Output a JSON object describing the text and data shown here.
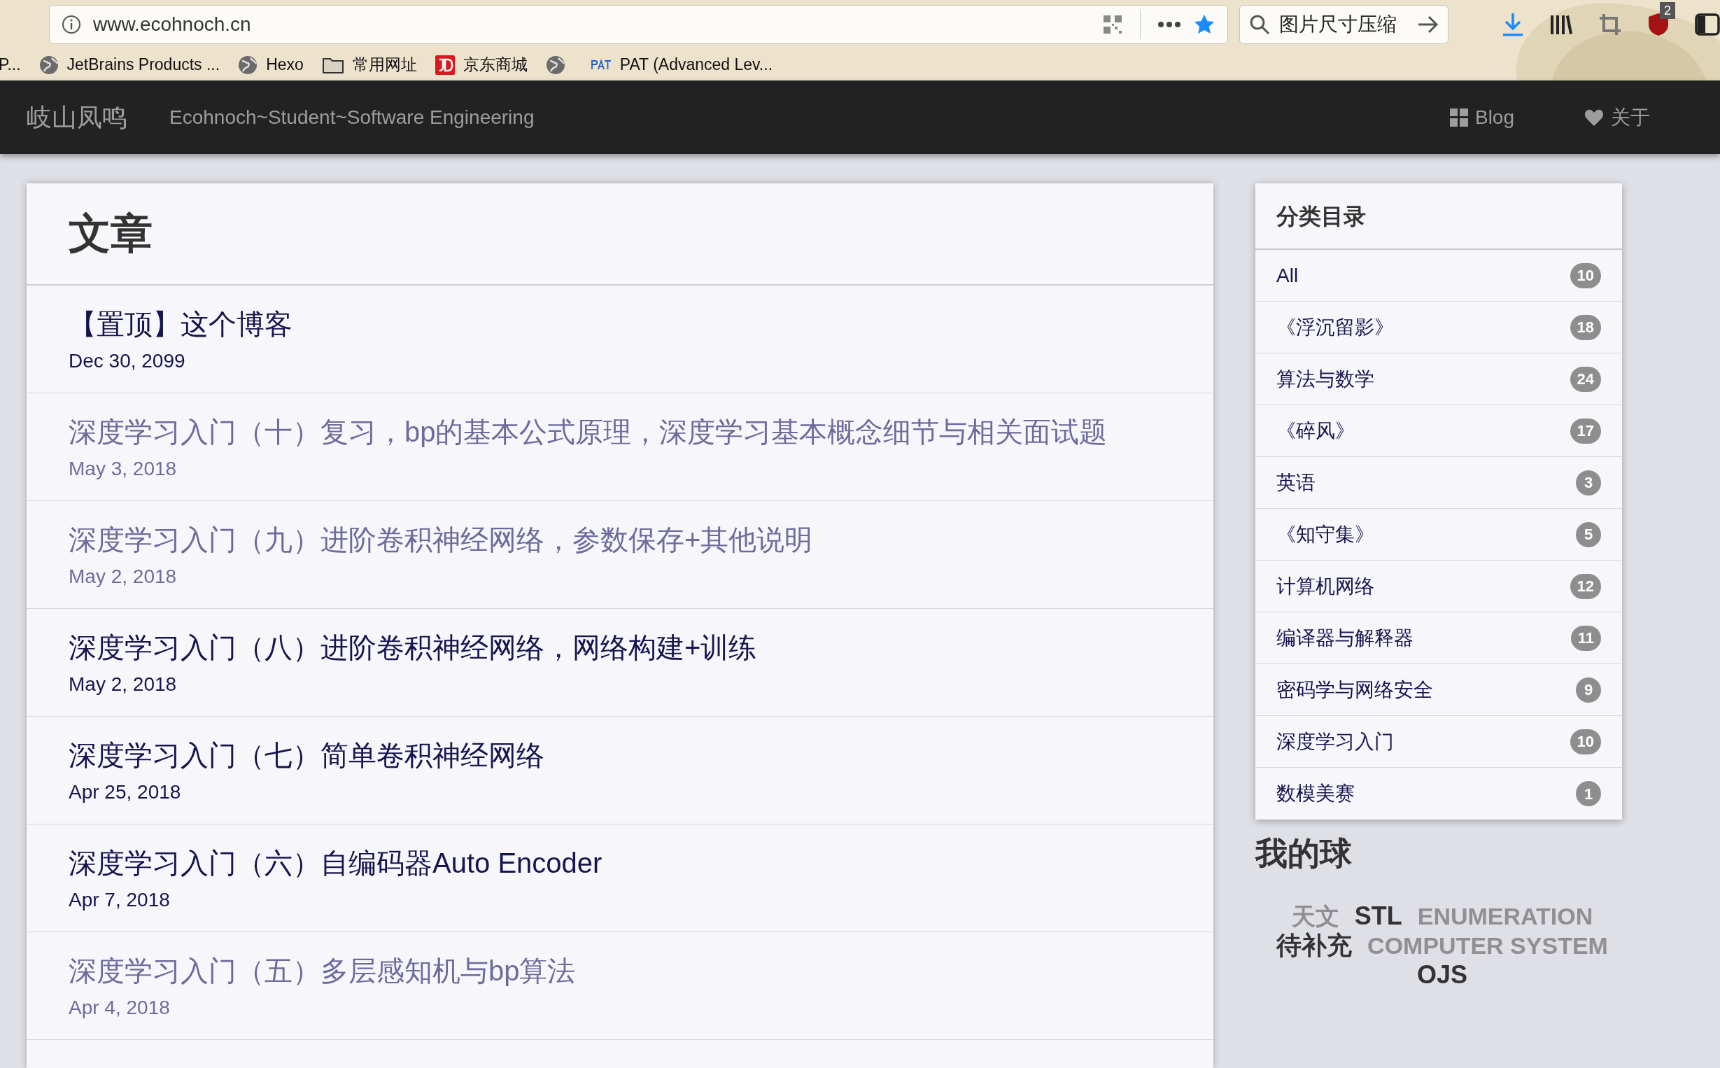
{
  "browser": {
    "url": "www.ecohnoch.cn",
    "search_text": "图片尺寸压缩",
    "addon_badge": "2",
    "bookmarks": [
      {
        "kind": "plain",
        "label": "P..."
      },
      {
        "kind": "globe",
        "label": "JetBrains Products ..."
      },
      {
        "kind": "globe",
        "label": "Hexo"
      },
      {
        "kind": "folder",
        "label": "常用网址"
      },
      {
        "kind": "jd",
        "label": "京东商城"
      },
      {
        "kind": "globe"
      },
      {
        "kind": "pat",
        "label": "PAT (Advanced Lev..."
      }
    ]
  },
  "navbar": {
    "brand": "岐山凤鸣",
    "subtitle": "Ecohnoch~Student~Software Engineering",
    "links": [
      {
        "kind": "grid",
        "label": "Blog"
      },
      {
        "kind": "heart",
        "label": "关于"
      }
    ]
  },
  "articles": {
    "heading": "文章",
    "items": [
      {
        "title": "【置顶】这个博客",
        "date": "Dec 30, 2099",
        "visited": false
      },
      {
        "title": "深度学习入门（十）复习，bp的基本公式原理，深度学习基本概念细节与相关面试题",
        "date": "May 3, 2018",
        "visited": true
      },
      {
        "title": "深度学习入门（九）进阶卷积神经网络，参数保存+其他说明",
        "date": "May 2, 2018",
        "visited": true
      },
      {
        "title": "深度学习入门（八）进阶卷积神经网络，网络构建+训练",
        "date": "May 2, 2018",
        "visited": false
      },
      {
        "title": "深度学习入门（七）简单卷积神经网络",
        "date": "Apr 25, 2018",
        "visited": false
      },
      {
        "title": "深度学习入门（六）自编码器Auto Encoder",
        "date": "Apr 7, 2018",
        "visited": false
      },
      {
        "title": "深度学习入门（五）多层感知机与bp算法",
        "date": "Apr 4, 2018",
        "visited": true
      }
    ]
  },
  "categories": {
    "heading": "分类目录",
    "items": [
      {
        "label": "All",
        "count": "10"
      },
      {
        "label": "《浮沉留影》",
        "count": "18"
      },
      {
        "label": "算法与数学",
        "count": "24"
      },
      {
        "label": "《碎风》",
        "count": "17"
      },
      {
        "label": "英语",
        "count": "3"
      },
      {
        "label": "《知守集》",
        "count": "5"
      },
      {
        "label": "计算机网络",
        "count": "12"
      },
      {
        "label": "编译器与解释器",
        "count": "11"
      },
      {
        "label": "密码学与网络安全",
        "count": "9"
      },
      {
        "label": "深度学习入门",
        "count": "10"
      },
      {
        "label": "数模美赛",
        "count": "1"
      }
    ]
  },
  "tag_cloud": {
    "heading": "我的球",
    "tags": [
      {
        "label": "天文",
        "kind": "faint"
      },
      {
        "label": "STL",
        "kind": "strong"
      },
      {
        "label": "ENUMERATION",
        "kind": "faint"
      },
      {
        "label": "待补充",
        "kind": "strong"
      },
      {
        "label": "COMPUTER SYSTEM",
        "kind": "faint"
      },
      {
        "label": "OJS",
        "kind": "strong"
      }
    ]
  }
}
